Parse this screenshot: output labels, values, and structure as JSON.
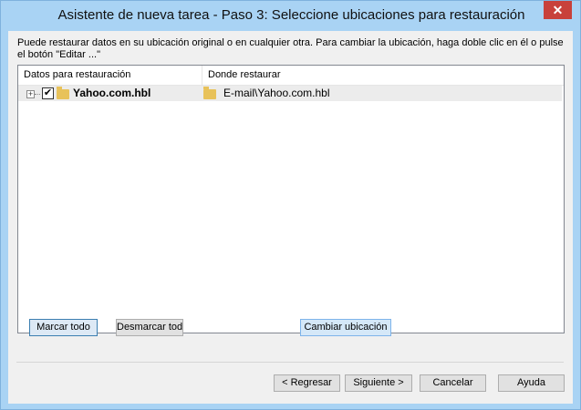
{
  "window": {
    "title": "Asistente de nueva tarea - Paso 3: Seleccione ubicaciones para restauración",
    "close_glyph": "✕"
  },
  "description": "Puede restaurar datos en su ubicación original o en cualquier otra. Para cambiar la ubicación, haga doble clic en él o pulse el botón \"Editar ...\"",
  "tree": {
    "columns": [
      "Datos para restauración",
      "Donde restaurar"
    ],
    "rows": [
      {
        "expander": "+",
        "checked": "✔",
        "name": "Yahoo.com.hbl",
        "destination": "E-mail\\Yahoo.com.hbl"
      }
    ]
  },
  "actions": {
    "mark_all": "Marcar todo",
    "unmark_all": "Desmarcar todo",
    "change_location": "Cambiar ubicación"
  },
  "footer": {
    "back": "< Regresar",
    "next": "Siguiente >",
    "cancel": "Cancelar",
    "help": "Ayuda"
  }
}
